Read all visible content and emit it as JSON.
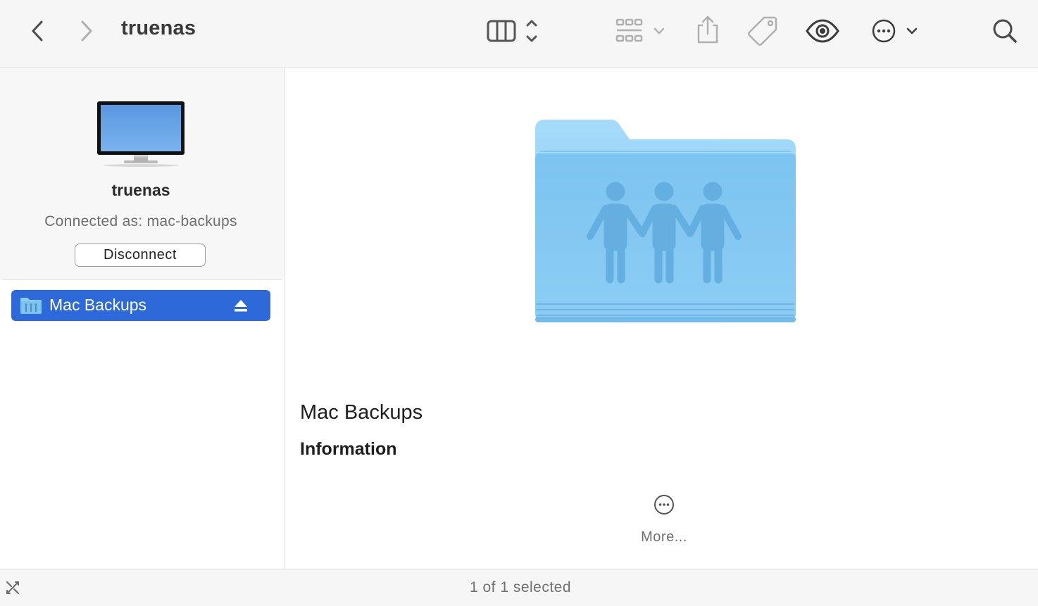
{
  "window": {
    "title": "truenas"
  },
  "toolbar": {
    "back": "chevron-left-icon",
    "forward": "chevron-right-icon",
    "view": "column-view-icon",
    "group": "icon-grid-icon",
    "share": "share-icon",
    "tag": "tag-icon",
    "quicklook": "eye-icon",
    "actions": "ellipsis-circle-icon",
    "search": "search-icon"
  },
  "sidebar": {
    "server": {
      "name": "truenas",
      "connection": "Connected as: mac-backups",
      "disconnect_label": "Disconnect"
    },
    "items": [
      {
        "label": "Mac Backups",
        "selected": true,
        "icon": "shared-folder-icon",
        "eject": "eject-icon"
      }
    ]
  },
  "preview": {
    "name": "Mac Backups",
    "section": "Information",
    "more_label": "More..."
  },
  "status": {
    "text": "1 of 1 selected"
  },
  "colors": {
    "selection": "#2e69d9",
    "folder": "#8ccdf4",
    "toolbar_bg": "#f6f6f6"
  }
}
